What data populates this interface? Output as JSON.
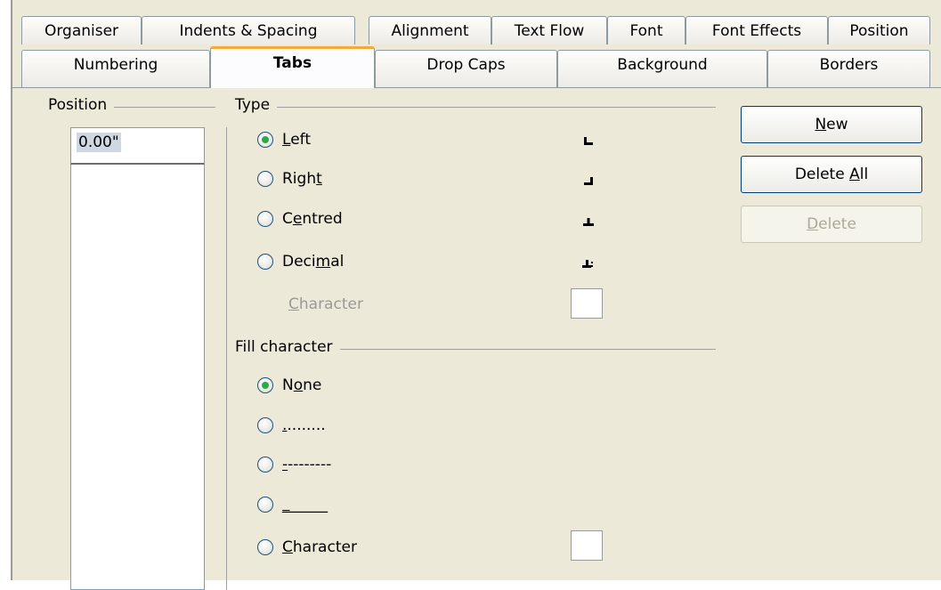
{
  "tabs_row1": [
    {
      "label": "Organiser"
    },
    {
      "label": "Indents & Spacing"
    },
    {
      "label": "Alignment"
    },
    {
      "label": "Text Flow"
    },
    {
      "label": "Font"
    },
    {
      "label": "Font Effects"
    },
    {
      "label": "Position"
    }
  ],
  "tabs_row2": [
    {
      "label": "Numbering"
    },
    {
      "label": "Tabs",
      "active": true
    },
    {
      "label": "Drop Caps"
    },
    {
      "label": "Background"
    },
    {
      "label": "Borders"
    }
  ],
  "position": {
    "group_label": "Position",
    "value": "0.00\""
  },
  "type": {
    "group_label": "Type",
    "options": [
      {
        "prefix": "",
        "ul": "L",
        "suffix": "eft",
        "checked": true,
        "icon": "tab-left-icon"
      },
      {
        "prefix": "Righ",
        "ul": "t",
        "suffix": "",
        "checked": false,
        "icon": "tab-right-icon"
      },
      {
        "prefix": "C",
        "ul": "e",
        "suffix": "ntred",
        "checked": false,
        "icon": "tab-centred-icon"
      },
      {
        "prefix": "Deci",
        "ul": "m",
        "suffix": "al",
        "checked": false,
        "icon": "tab-decimal-icon"
      }
    ],
    "character_label_ul": "C",
    "character_label_rest": "haracter"
  },
  "fill": {
    "group_label": "Fill character",
    "options": [
      {
        "prefix": "N",
        "ul": "o",
        "suffix": "ne",
        "checked": true
      },
      {
        "prefix": "",
        "ul": ".",
        "suffix": "........",
        "checked": false
      },
      {
        "prefix": "",
        "ul": "-",
        "suffix": "--------",
        "checked": false
      },
      {
        "prefix": "",
        "ul": "_",
        "suffix": "_____",
        "checked": false
      },
      {
        "prefix": "",
        "ul": "C",
        "suffix": "haracter",
        "checked": false
      }
    ]
  },
  "buttons": {
    "new": {
      "ul": "N",
      "rest": "ew"
    },
    "delete_all": {
      "pre": "Delete ",
      "ul": "A",
      "rest": "ll"
    },
    "delete": {
      "ul": "D",
      "rest": "elete"
    }
  },
  "colors": {
    "dialog_bg": "#ece9d8",
    "active_tab_accent": "#f3a83b",
    "radio_checked": "#2fa84a"
  }
}
